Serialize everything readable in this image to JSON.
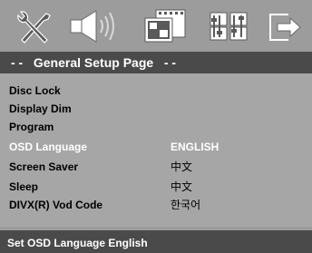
{
  "header": {
    "icons": [
      {
        "name": "general-setup-icon"
      },
      {
        "name": "audio-setup-icon"
      },
      {
        "name": "video-setup-icon"
      },
      {
        "name": "preference-setup-icon"
      },
      {
        "name": "exit-setup-icon"
      }
    ],
    "title": "- -   General Setup Page   - -"
  },
  "menu": {
    "items": [
      {
        "label": "Disc Lock",
        "value": ""
      },
      {
        "label": "Display Dim",
        "value": ""
      },
      {
        "label": "Program",
        "value": ""
      },
      {
        "label": "OSD Language",
        "value": "ENGLISH",
        "selected": true
      },
      {
        "label": "Screen Saver",
        "value": "中文"
      },
      {
        "label": "Sleep",
        "value": "中文"
      },
      {
        "label": "DIVX(R) Vod Code",
        "value": "한국어"
      }
    ]
  },
  "status": {
    "text": "Set OSD Language English"
  },
  "colors": {
    "background": "#9c9c9c",
    "menu_background": "#a6a6a6",
    "bar": "#4a4a4a",
    "selected_text": "#ffffff",
    "text": "#000000"
  }
}
